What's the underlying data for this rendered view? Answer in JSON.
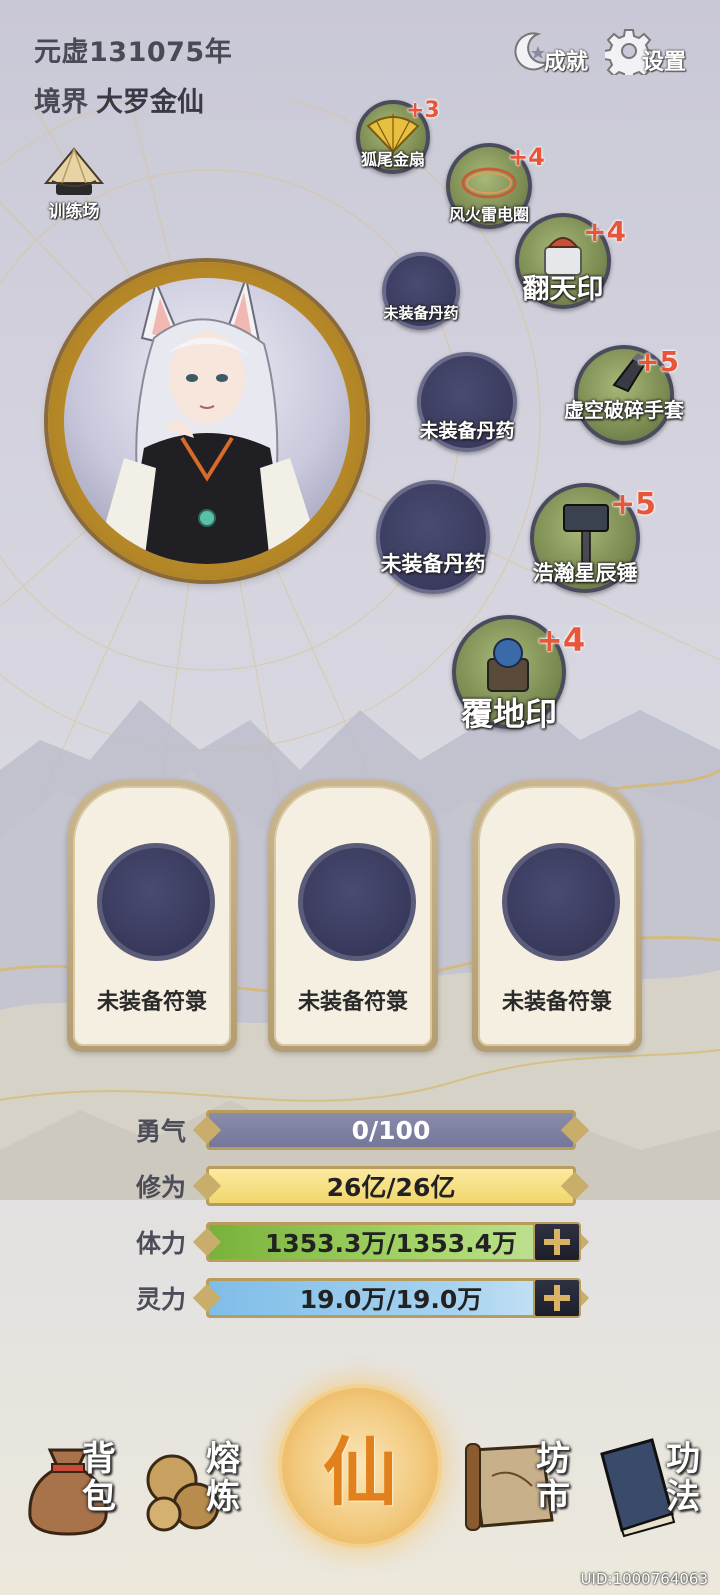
{
  "header": {
    "year": "元虚131075年",
    "realm_label": "境界",
    "realm_value": "大罗金仙"
  },
  "top_buttons": {
    "achievement_label": "成就",
    "settings_label": "设置"
  },
  "training": {
    "label": "训练场"
  },
  "slots": {
    "s1": {
      "name": "狐尾金扇",
      "plus": "+3"
    },
    "s2": {
      "name": "风火雷电圈",
      "plus": "+4"
    },
    "s3": {
      "name": "翻天印",
      "plus": "+4"
    },
    "s4": {
      "name": "未装备丹药"
    },
    "s5": {
      "name": "未装备丹药"
    },
    "s6": {
      "name": "虚空破碎手套",
      "plus": "+5"
    },
    "s7": {
      "name": "未装备丹药"
    },
    "s8": {
      "name": "浩瀚星辰锤",
      "plus": "+5"
    },
    "s9": {
      "name": "覆地印",
      "plus": "+4"
    }
  },
  "talismans": [
    {
      "label": "未装备符箓"
    },
    {
      "label": "未装备符箓"
    },
    {
      "label": "未装备符箓"
    }
  ],
  "stats": {
    "courage": {
      "label": "勇气",
      "value": "0/100",
      "fill": 0.0
    },
    "cultivation": {
      "label": "修为",
      "value": "26亿/26亿",
      "fill": 1.0
    },
    "stamina": {
      "label": "体力",
      "value": "1353.3万/1353.4万",
      "fill": 1.0
    },
    "spirit": {
      "label": "灵力",
      "value": "19.0万/19.0万",
      "fill": 1.0
    }
  },
  "nav": {
    "bag": [
      "背",
      "包"
    ],
    "smelt": [
      "熔",
      "炼"
    ],
    "center": "仙",
    "market": [
      "坊",
      "市"
    ],
    "skills": [
      "功",
      "法"
    ]
  },
  "uid": "UID:1000764063",
  "colors": {
    "plus_text": "#e8563a",
    "center_glyph": "#e2801c",
    "gold_frame": "#c9a23a"
  }
}
